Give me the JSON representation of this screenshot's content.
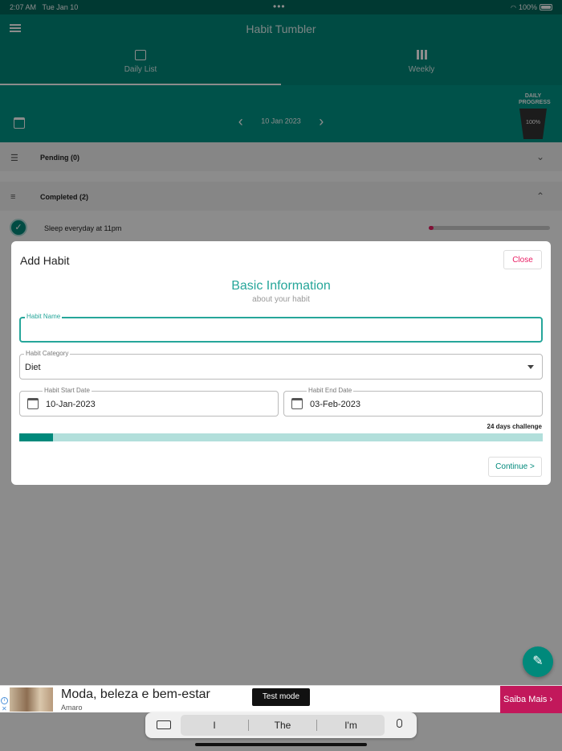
{
  "status": {
    "time": "2:07 AM",
    "date": "Tue Jan 10",
    "dots": "•••",
    "battery": "100%"
  },
  "app": {
    "title": "Habit Tumbler"
  },
  "tabs": [
    {
      "label": "Daily List"
    },
    {
      "label": "Weekly"
    }
  ],
  "datebar": {
    "date": "10 Jan 2023",
    "progress_label_1": "DAILY",
    "progress_label_2": "PROGRESS",
    "progress_value": "100%"
  },
  "sections": {
    "pending": "Pending (0)",
    "completed": "Completed (2)"
  },
  "habit": {
    "name": "Sleep everyday at 11pm",
    "progress_fraction": 0.04
  },
  "modal": {
    "title": "Add Habit",
    "close_label": "Close",
    "section_title": "Basic Information",
    "section_subtitle": "about your habit",
    "habit_name": {
      "label": "Habit Name",
      "value": ""
    },
    "habit_category": {
      "label": "Habit Category",
      "value": "Diet"
    },
    "start_date": {
      "label": "Habit Start Date",
      "value": "10-Jan-2023"
    },
    "end_date": {
      "label": "Habit End Date",
      "value": "03-Feb-2023"
    },
    "challenge_text": "24 days challenge",
    "progress_fraction": 0.065,
    "continue_label": "Continue >"
  },
  "ad": {
    "headline": "Moda, beleza e bem-estar",
    "brand": "Amaro",
    "test_mode": "Test mode",
    "cta": "Saiba Mais",
    "cta_icon": "›"
  },
  "keyboard": {
    "suggestions": [
      "I",
      "The",
      "I'm"
    ]
  },
  "colors": {
    "primary": "#00897b",
    "accent": "#26a69a",
    "danger": "#e91e63"
  }
}
